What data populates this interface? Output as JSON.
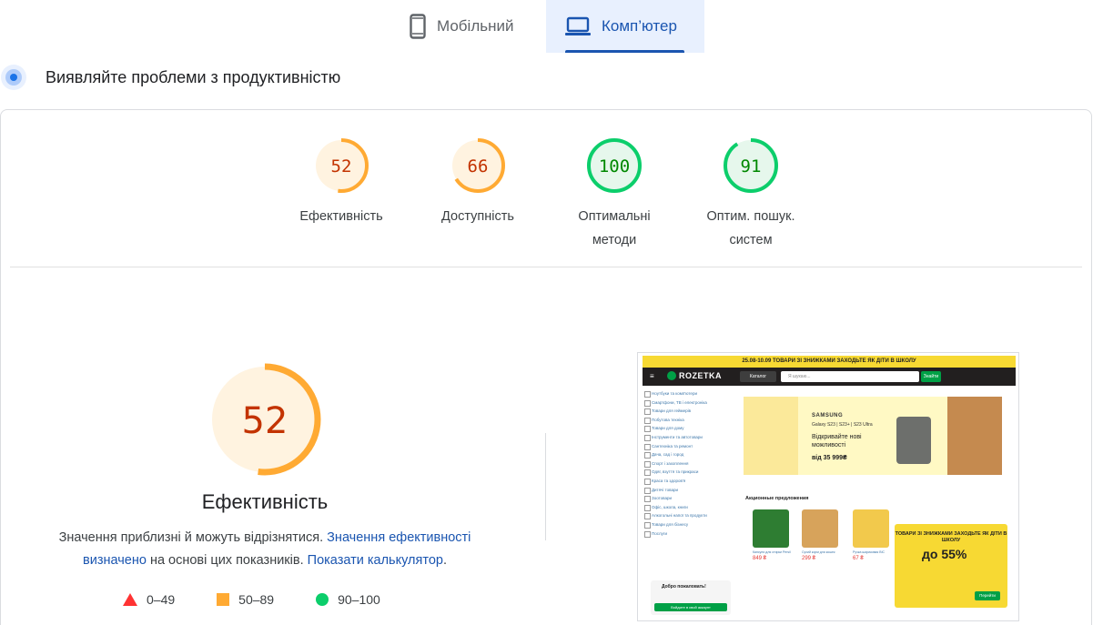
{
  "tabs": {
    "mobile": {
      "label": "Мобільний",
      "icon": "phone-icon"
    },
    "desktop": {
      "label": "Комп’ютер",
      "icon": "laptop-icon",
      "active": true
    }
  },
  "heading": {
    "text": "Виявляйте проблеми з продуктивністю",
    "icon": "lighthouse-icon"
  },
  "scores": [
    {
      "value": "52",
      "label": "Ефективність",
      "color": "#ffaa33",
      "text_color": "#c33300",
      "bg": "#fff3e0",
      "fraction": 0.52
    },
    {
      "value": "66",
      "label": "Доступність",
      "color": "#ffaa33",
      "text_color": "#c33300",
      "bg": "#fff3e0",
      "fraction": 0.66
    },
    {
      "value": "100",
      "label_line1": "Оптимальні",
      "label_line2": "методи",
      "color": "#0cce6b",
      "text_color": "#008800",
      "bg": "#e6f7ec",
      "fraction": 1.0
    },
    {
      "value": "91",
      "label_line1": "Оптим. пошук.",
      "label_line2": "систем",
      "color": "#0cce6b",
      "text_color": "#008800",
      "bg": "#e6f7ec",
      "fraction": 0.91
    }
  ],
  "main_score": {
    "value": "52",
    "label": "Ефективність",
    "fraction": 0.52
  },
  "description": {
    "text1": "Значення приблизні й можуть відрізнятися. ",
    "link1": "Значення ефективності визначено",
    "text2": " на основі цих показників. ",
    "link2": "Показати калькулятор",
    "text3": "."
  },
  "legend": [
    {
      "icon": "red-triangle-icon",
      "label": "0–49"
    },
    {
      "icon": "orange-square-icon",
      "label": "50–89"
    },
    {
      "icon": "green-circle-icon",
      "label": "90–100"
    }
  ],
  "screenshot": {
    "promo": "25.08-10.09 ТОВАРИ ЗІ ЗНИЖКАМИ ЗАХОДЬТЕ ЯК ДІТИ В ШКОЛУ",
    "logo": "ROZETKA",
    "catalog": "Каталог",
    "search_placeholder": "Я шукаю...",
    "find": "Знайти",
    "sidebar": [
      "Ноутбуки та комп'ютери",
      "Смартфони, ТВ і електроніка",
      "Товари для геймерів",
      "Побутова техніка",
      "Товари для дому",
      "Інструменти та автотовари",
      "Сантехніка та ремонт",
      "Дача, сад і город",
      "Спорт і захоплення",
      "Одяг, взуття та прикраси",
      "Краса та здоров'я",
      "Дитячі товари",
      "Зоотовари",
      "Офіс, школа, книги",
      "Алкогольні напої та продукти",
      "Товари для бізнесу",
      "Послуги"
    ],
    "banner": {
      "brand": "SAMSUNG",
      "model": "Galaxy S23 | S23+ | S23 Ultra",
      "headline": "Відкривайте нові можливості",
      "price": "від 35 999₴"
    },
    "products_title": "Акционные предложения",
    "products": [
      {
        "name": "Капсули для стирки Persil",
        "price": "849 ₴",
        "color": "#2e7d32"
      },
      {
        "name": "Сухий корм для кошек",
        "price": "299 ₴",
        "color": "#d7a35b"
      },
      {
        "name": "Ручка шариковая BIC",
        "price": "67 ₴",
        "color": "#f2c94c"
      }
    ],
    "popup": {
      "text": "ТОВАРИ ЗІ ЗНИЖКАМИ ЗАХОДЬТЕ ЯК ДІТИ В ШКОЛУ",
      "discount": "до 55%",
      "button": "Перейти"
    },
    "login": {
      "title": "Добро пожаловать!",
      "button": "Войдите в свой аккаунт"
    }
  }
}
